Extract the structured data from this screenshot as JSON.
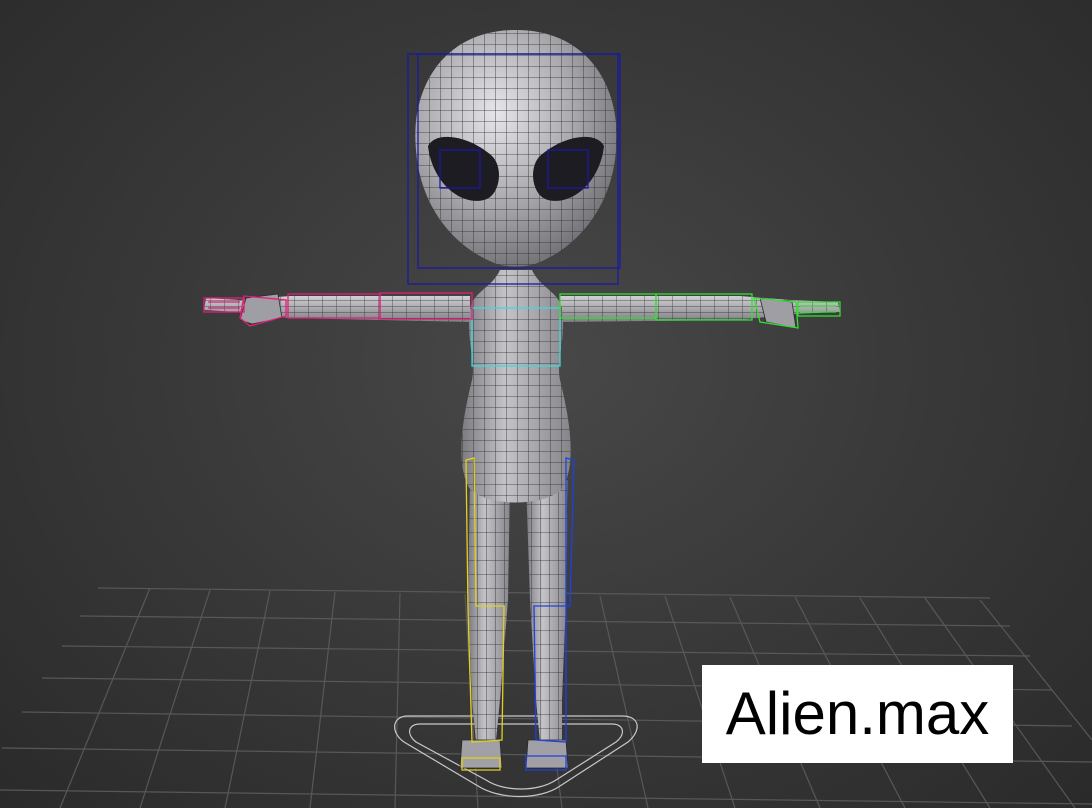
{
  "viewport": {
    "filename": "Alien.max"
  },
  "scene": {
    "model_icon": "alien-character-model",
    "grid_icon": "ground-grid",
    "colors": {
      "background": "#3a3a3a",
      "grid_line": "#5a5a5a",
      "mesh_fill": "#b8b8bc",
      "mesh_wire": "#2a2a2a",
      "head_bone": "#1a1aa0",
      "left_arm_bone": "#e0207a",
      "right_arm_bone": "#30e030",
      "spine_bone": "#40d8d8",
      "left_leg_bone": "#e0d020",
      "right_leg_bone": "#2040e0",
      "root_control": "#c8c8c8"
    }
  }
}
